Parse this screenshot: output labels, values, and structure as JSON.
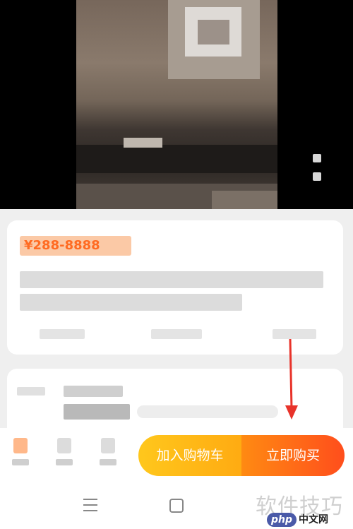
{
  "product": {
    "price_text": "¥288-8888",
    "title_lines": [
      "",
      ""
    ],
    "stats": [
      "",
      "",
      ""
    ]
  },
  "options": {
    "label": "",
    "spec_name": "",
    "spec_value": ""
  },
  "action_bar": {
    "nav": [
      {
        "name": "store",
        "icon": "store-icon",
        "label": ""
      },
      {
        "name": "service",
        "icon": "chat-icon",
        "label": ""
      },
      {
        "name": "cart",
        "icon": "cart-icon",
        "label": ""
      }
    ],
    "add_to_cart_label": "加入购物车",
    "buy_now_label": "立即购买"
  },
  "colors": {
    "add_to_cart": "#ffb814",
    "buy_now": "#ff5a1a",
    "price": "#ff6b22",
    "annotation_arrow": "#e8332a"
  },
  "watermark": {
    "cn_text": "软件技巧",
    "logo_php": "php",
    "logo_site": "中文网"
  }
}
